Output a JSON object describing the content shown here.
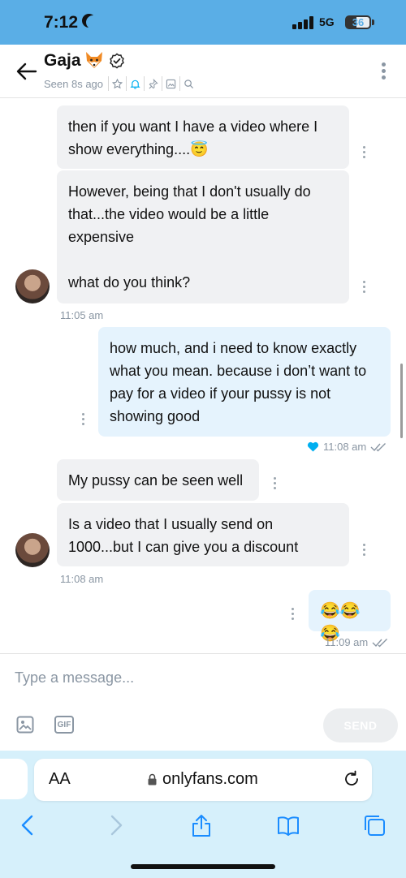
{
  "status_bar": {
    "time": "7:12",
    "network": "5G",
    "battery": "36"
  },
  "header": {
    "name": "Gaja",
    "seen": "Seen 8s ago"
  },
  "messages": [
    {
      "text": "then if you want I have a video where I show everything....😇"
    },
    {
      "text": "However, being that I don't usually do that...the video would be a little expensive\n\nwhat do you think?"
    },
    {
      "time": "11:05 am"
    },
    {
      "text": "how much, and i need to know exactly what you mean. because i don’t want to pay for a video if your pussy is not showing good"
    },
    {
      "time": "11:08 am"
    },
    {
      "text": "My pussy can be seen well"
    },
    {
      "text": "Is a video that I usually send on 1000...but I can give you a discount"
    },
    {
      "time": "11:08 am"
    },
    {
      "text": "😂😂😂"
    },
    {
      "time": "11:09 am"
    }
  ],
  "composer": {
    "placeholder": "Type a message...",
    "send_label": "SEND",
    "gif_label": "GIF"
  },
  "browser": {
    "aa_label": "AA",
    "url": "onlyfans.com"
  },
  "colors": {
    "accent": "#00aff0",
    "status_bar": "#5aaee6",
    "outgoing_bubble": "#e5f3fd",
    "incoming_bubble": "#f0f1f3"
  }
}
